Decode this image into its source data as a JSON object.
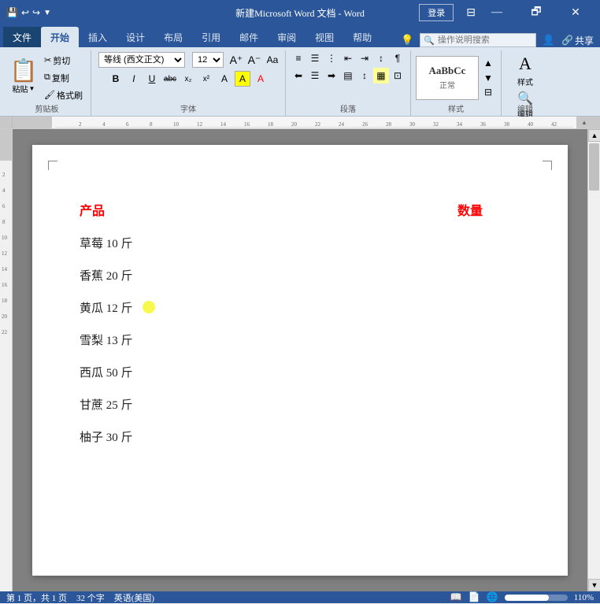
{
  "titlebar": {
    "title": "新建Microsoft Word 文档 - Word",
    "quick_save": "💾",
    "quick_undo": "↩",
    "quick_redo": "↪",
    "login_label": "登录",
    "win_minimize": "－",
    "win_restore": "🗗",
    "win_close": "✕"
  },
  "tabs": [
    {
      "label": "文件",
      "active": false
    },
    {
      "label": "开始",
      "active": true
    },
    {
      "label": "插入",
      "active": false
    },
    {
      "label": "设计",
      "active": false
    },
    {
      "label": "布局",
      "active": false
    },
    {
      "label": "引用",
      "active": false
    },
    {
      "label": "邮件",
      "active": false
    },
    {
      "label": "审阅",
      "active": false
    },
    {
      "label": "视图",
      "active": false
    },
    {
      "label": "帮助",
      "active": false
    }
  ],
  "ribbon": {
    "clipboard": {
      "label": "剪贴板",
      "paste": "粘贴",
      "cut": "剪切",
      "copy": "复制",
      "format_painter": "格式刷"
    },
    "font": {
      "label": "字体",
      "font_name": "等线 (西文正文)",
      "font_size": "12",
      "bold": "B",
      "italic": "I",
      "underline": "U",
      "strikethrough": "abc",
      "subscript": "x₂",
      "superscript": "x²"
    },
    "paragraph": {
      "label": "段落"
    },
    "styles": {
      "label": "样式"
    },
    "editing": {
      "label": "编辑"
    }
  },
  "help_search_placeholder": "操作说明搜索",
  "share_label": "共享",
  "document": {
    "header_product": "产品",
    "header_qty": "数量",
    "items": [
      "草莓 10 斤",
      "香蕉 20 斤",
      "黄瓜 12 斤",
      "雪梨 13 斤",
      "西瓜 50 斤",
      "甘蔗 25 斤",
      "柚子 30 斤"
    ]
  },
  "status": {
    "page": "第 1 页，共 1 页",
    "words": "32 个字",
    "lang": "英语(美国)",
    "zoom": "110%"
  }
}
